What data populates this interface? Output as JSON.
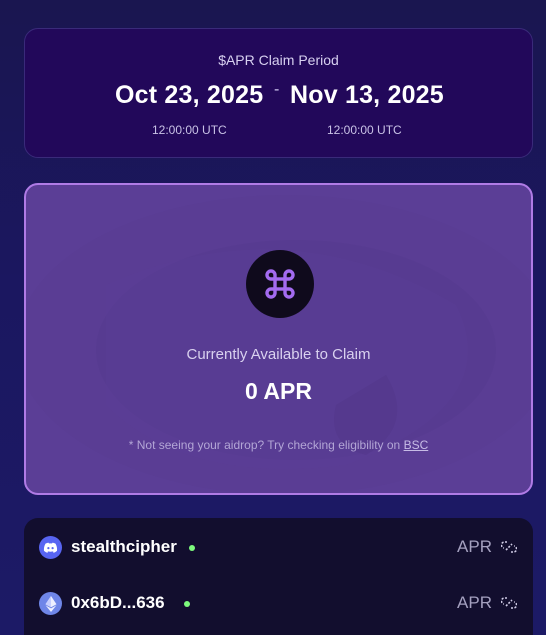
{
  "claim_period": {
    "title": "$APR Claim Period",
    "start_date": "Oct 23, 2025",
    "end_date": "Nov 13, 2025",
    "separator": "-",
    "start_time": "12:00:00 UTC",
    "end_time": "12:00:00 UTC"
  },
  "claim": {
    "available_label": "Currently Available to Claim",
    "amount": "0 APR",
    "hint_prefix": "* Not seeing your aidrop? Try checking eligibility on ",
    "hint_link": "BSC",
    "logo_icon": "command-icon"
  },
  "accounts": [
    {
      "icon": "discord-icon",
      "name": "stealthcipher",
      "token": "APR",
      "status": "online"
    },
    {
      "icon": "ethereum-icon",
      "name": "0x6bD...636",
      "token": "APR",
      "status": "online"
    }
  ],
  "colors": {
    "accent": "#b07be6",
    "status_online": "#7dfa7d",
    "discord": "#5865f2",
    "ethereum": "#6f86e8"
  }
}
